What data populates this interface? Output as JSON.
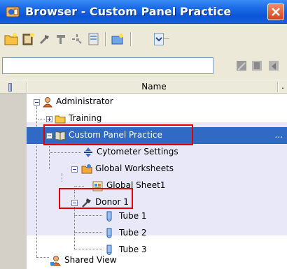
{
  "window": {
    "title": "Browser - Custom Panel Practice"
  },
  "toolbar": {
    "icons": [
      "new-folder-icon",
      "new-experiment-icon",
      "new-tube-icon",
      "new-worksheet-icon",
      "new-specimen-icon",
      "new-panel-icon",
      "new-global-icon",
      "dropdown-icon"
    ]
  },
  "search": {
    "value": "",
    "placeholder": ""
  },
  "columns": {
    "icon_col": "",
    "name": "Name",
    "extra": "."
  },
  "tree": {
    "nodes": [
      {
        "label": "Administrator",
        "icon": "user-icon"
      },
      {
        "label": "Training",
        "icon": "folder-icon"
      },
      {
        "label": "Custom Panel Practice",
        "icon": "book-icon",
        "trailing": "..."
      },
      {
        "label": "Cytometer Settings",
        "icon": "cytometer-settings-icon"
      },
      {
        "label": "Global Worksheets",
        "icon": "global-worksheets-icon"
      },
      {
        "label": "Global Sheet1",
        "icon": "worksheet-icon"
      },
      {
        "label": "Donor 1",
        "icon": "specimen-icon"
      },
      {
        "label": "Tube 1",
        "icon": "tube-icon"
      },
      {
        "label": "Tube 2",
        "icon": "tube-icon"
      },
      {
        "label": "Tube 3",
        "icon": "tube-icon"
      },
      {
        "label": "Shared View",
        "icon": "shared-user-icon"
      }
    ]
  },
  "colors": {
    "selection": "#316ac5",
    "highlight_box": "#e00000",
    "titlebar": "#0a55d6"
  }
}
